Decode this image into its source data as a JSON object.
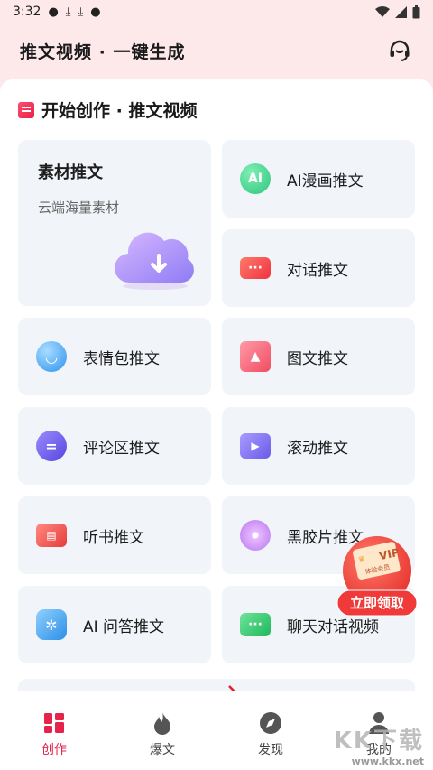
{
  "status": {
    "time": "3:32"
  },
  "header": {
    "title": "推文视频 · 一键生成"
  },
  "section": {
    "title": "开始创作 · 推文视频"
  },
  "big_tile": {
    "title": "素材推文",
    "subtitle": "云端海量素材"
  },
  "tiles": [
    {
      "label": "AI漫画推文",
      "icon": "ai-comic-icon",
      "icon_text": "AI",
      "color": "#3dd68c"
    },
    {
      "label": "对话推文",
      "icon": "dialog-icon",
      "color": "#f5434d"
    },
    {
      "label": "表情包推文",
      "icon": "emoji-icon",
      "color": "#3fa6f5"
    },
    {
      "label": "图文推文",
      "icon": "image-icon",
      "color": "#ff6b81"
    },
    {
      "label": "评论区推文",
      "icon": "comment-icon",
      "color": "#6b5cf0"
    },
    {
      "label": "滚动推文",
      "icon": "scroll-play-icon",
      "color": "#7c6cf2"
    },
    {
      "label": "听书推文",
      "icon": "book-icon",
      "color": "#f3504f"
    },
    {
      "label": "黑胶片推文",
      "icon": "vinyl-icon",
      "color": "#c987f0"
    },
    {
      "label": "AI 问答推文",
      "icon": "qa-icon",
      "color": "#39a6ee"
    },
    {
      "label": "聊天对话视频",
      "icon": "chat-icon",
      "color": "#27c46b"
    }
  ],
  "vip": {
    "tag": "VIP",
    "sub": "体验会员",
    "button": "立即领取"
  },
  "tabbar": [
    {
      "label": "创作",
      "icon": "grid-icon",
      "active": true
    },
    {
      "label": "爆文",
      "icon": "flame-icon",
      "active": false
    },
    {
      "label": "发现",
      "icon": "compass-icon",
      "active": false
    },
    {
      "label": "我的",
      "icon": "user-icon",
      "active": false
    }
  ],
  "watermark": {
    "text": "KK下载",
    "url": "www.kkx.net"
  },
  "colors": {
    "accent": "#e6234a",
    "header_bg": "#fde8ea",
    "tile_bg": "#f1f4f9"
  }
}
